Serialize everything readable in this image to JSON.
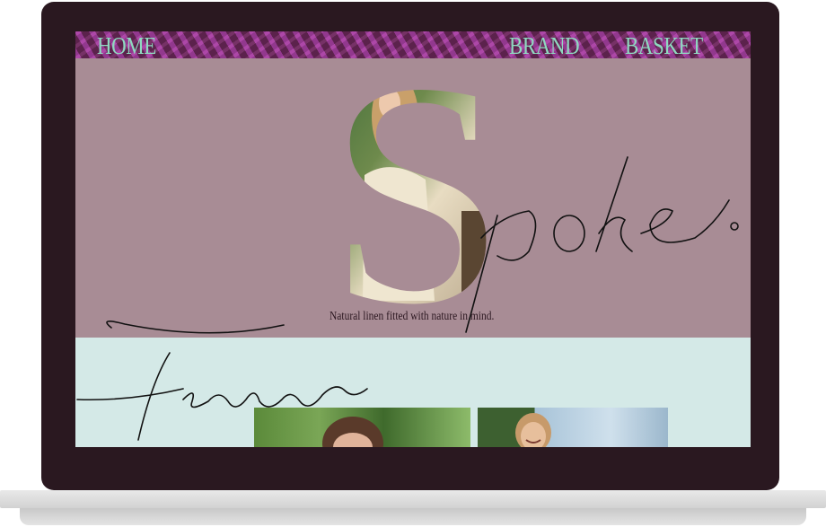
{
  "nav": {
    "home_label": "HOME",
    "brand_label": "BRAND",
    "basket_label": "BASKET"
  },
  "hero": {
    "logo_letter": "S",
    "logo_script": "poke.",
    "tagline": "Natural linen fitted with nature in mind."
  },
  "featured": {
    "heading": "Featured"
  },
  "colors": {
    "bezel": "#2a1820",
    "hero_background": "#a88c95",
    "featured_background": "#d4e9e7",
    "nav_text": "#8fd9c0"
  }
}
